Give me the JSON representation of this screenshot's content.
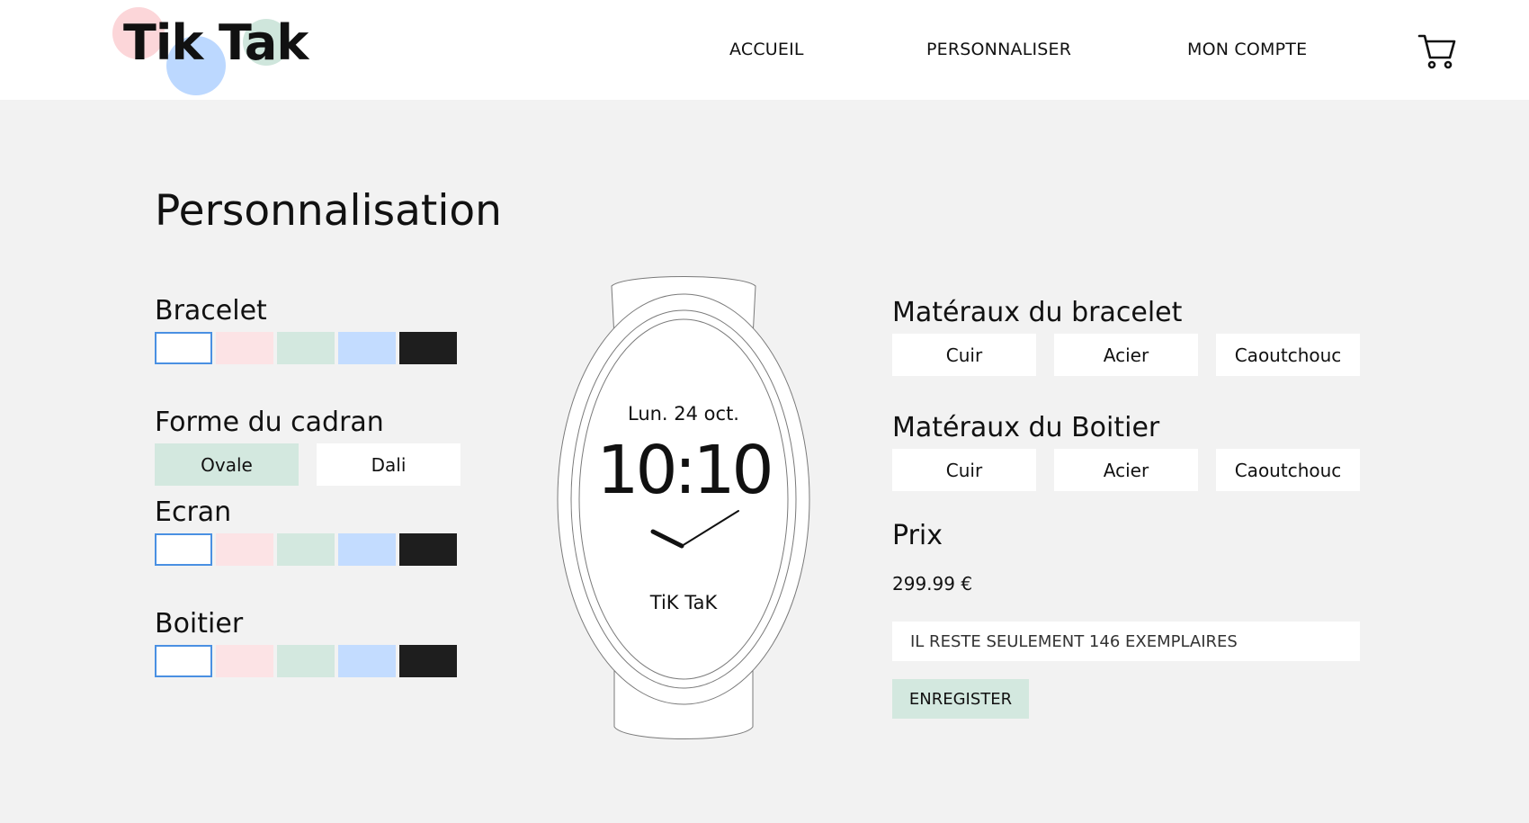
{
  "brand": {
    "logo_text": "Tik Tak",
    "colors": [
      "#fcd6d9",
      "#cfe6dc",
      "#bcd8ff"
    ]
  },
  "nav": {
    "items": [
      {
        "label": "ACCUEIL"
      },
      {
        "label": "PERSONNALISER"
      },
      {
        "label": "MON COMPTE"
      }
    ],
    "cart_icon": "shopping-cart-icon"
  },
  "page": {
    "title": "Personnalisation"
  },
  "options": {
    "bracelet": {
      "label": "Bracelet",
      "colors": [
        "#ffffff",
        "#fce3e5",
        "#d3e8df",
        "#c3dcff",
        "#1e1e1e"
      ],
      "selected": 0
    },
    "forme": {
      "label": "Forme du cadran",
      "choices": [
        "Ovale",
        "Dali"
      ],
      "selected": "Ovale"
    },
    "ecran": {
      "label": "Ecran",
      "colors": [
        "#ffffff",
        "#fce3e5",
        "#d3e8df",
        "#c3dcff",
        "#1e1e1e"
      ],
      "selected": 0
    },
    "boitier": {
      "label": "Boitier",
      "colors": [
        "#ffffff",
        "#fce3e5",
        "#d3e8df",
        "#c3dcff",
        "#1e1e1e"
      ],
      "selected": 0
    }
  },
  "watch": {
    "date": "Lun. 24 oct.",
    "time": "10:10",
    "brand": "TiK TaK"
  },
  "materials": {
    "bracelet": {
      "label": "Matéraux du bracelet",
      "choices": [
        "Cuir",
        "Acier",
        "Caoutchouc"
      ]
    },
    "boitier": {
      "label": "Matéraux du Boitier",
      "choices": [
        "Cuir",
        "Acier",
        "Caoutchouc"
      ]
    }
  },
  "pricing": {
    "label": "Prix",
    "value": "299.99 €",
    "stock_text": "IL RESTE SEULEMENT 146 EXEMPLAIRES",
    "save_label": "ENREGISTER"
  },
  "accent_color": "#d3e8df",
  "selection_border_color": "#4a90e2"
}
